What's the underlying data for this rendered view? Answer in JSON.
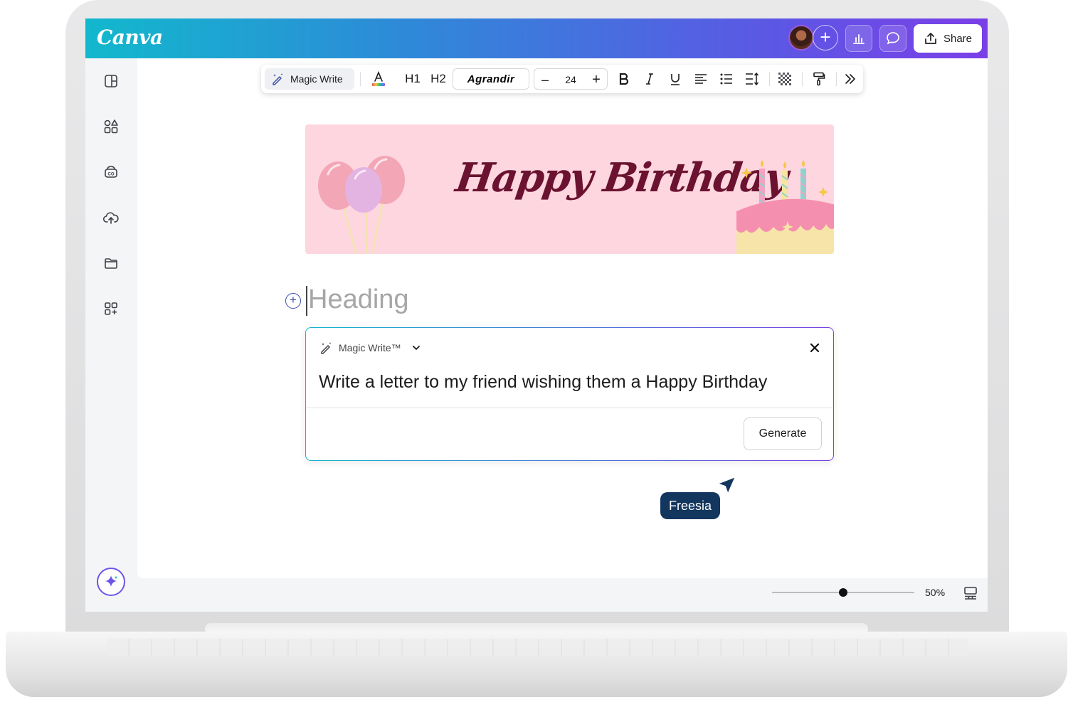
{
  "app": {
    "logo": "Canva"
  },
  "header": {
    "share_label": "Share"
  },
  "toolbar": {
    "magic_write_label": "Magic Write",
    "h1_label": "H1",
    "h2_label": "H2",
    "font_name": "Agrandir",
    "font_size": "24",
    "decrease_label": "–",
    "increase_label": "+"
  },
  "banner": {
    "title": "Happy Birthday"
  },
  "editor": {
    "heading_placeholder": "Heading"
  },
  "magic_write": {
    "title": "Magic Write™",
    "prompt": "Write a letter to my friend wishing them a Happy Birthday",
    "generate_label": "Generate"
  },
  "collaborator": {
    "name": "Freesia",
    "color": "#13365e"
  },
  "footer": {
    "zoom": "50%",
    "zoom_fraction": 0.5
  },
  "colors": {
    "brand_gradient_start": "#12b8cd",
    "brand_gradient_end": "#7b3fe8",
    "banner_bg": "#fdd6df",
    "banner_text": "#6b1231"
  }
}
